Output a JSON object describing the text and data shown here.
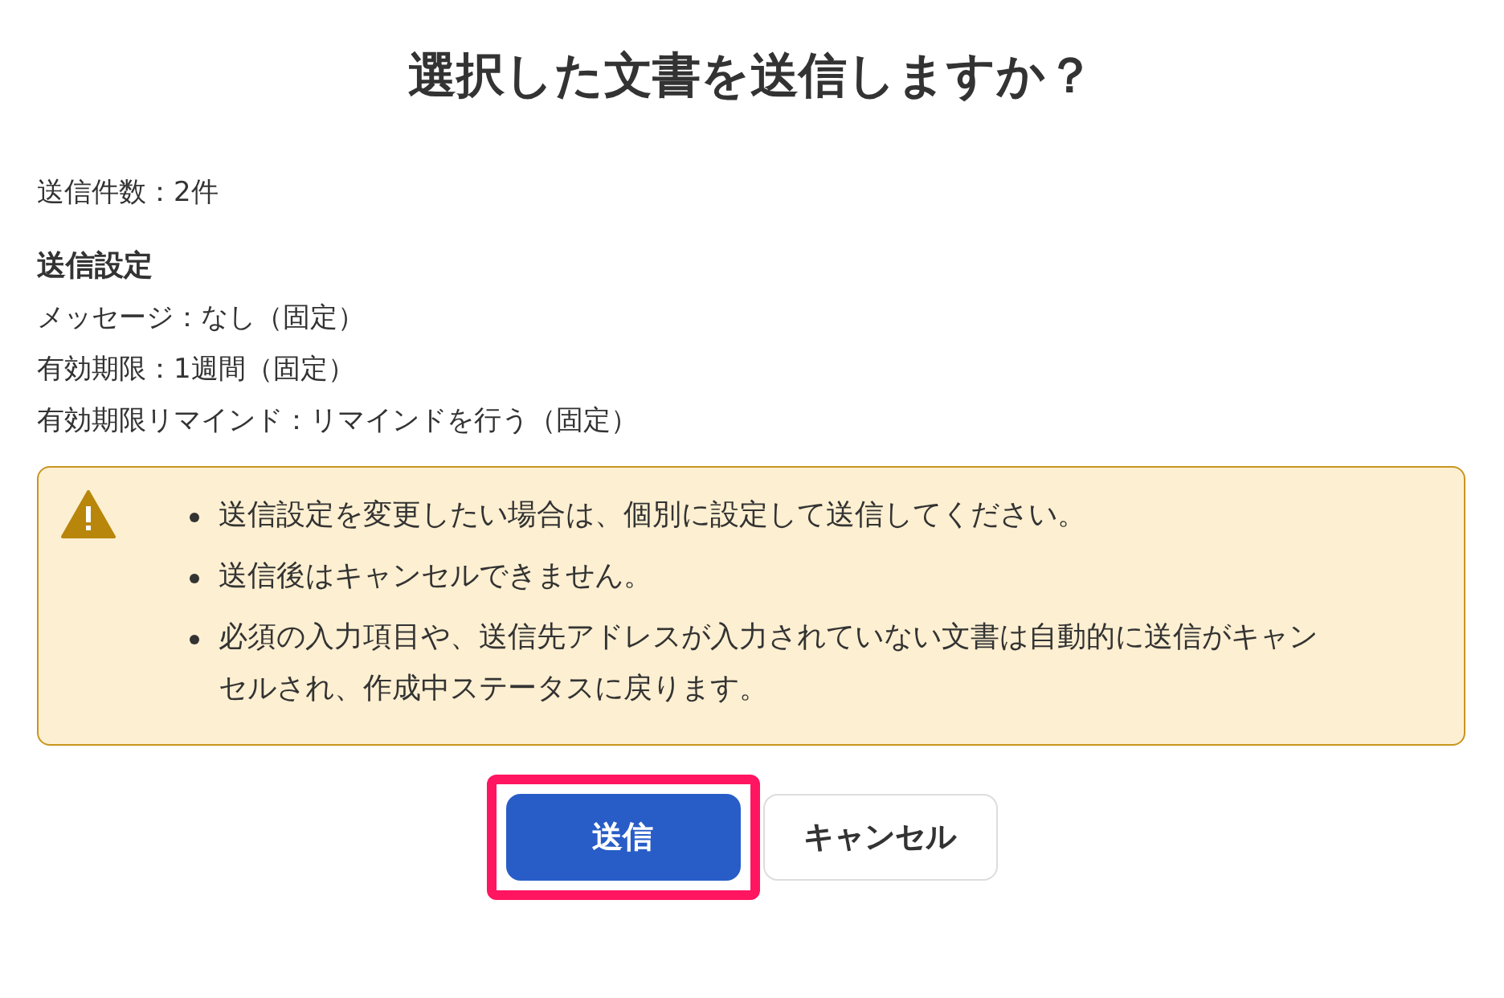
{
  "title": "選択した文書を送信しますか？",
  "count": "送信件数：2件",
  "settings": {
    "heading": "送信設定",
    "lines": [
      "メッセージ：なし（固定）",
      "有効期限：1週間（固定）",
      "有効期限リマインド：リマインドを行う（固定）"
    ]
  },
  "warning": {
    "items": [
      "送信設定を変更したい場合は、個別に設定して送信してください。",
      "送信後はキャンセルできません。",
      "必須の入力項目や、送信先アドレスが入力されていない文書は自動的に送信がキャンセルされ、作成中ステータスに戻ります。"
    ]
  },
  "buttons": [
    {
      "label": "送信",
      "kind": "primary",
      "highlighted": true
    },
    {
      "label": "キャンセル",
      "kind": "secondary",
      "highlighted": false
    }
  ]
}
